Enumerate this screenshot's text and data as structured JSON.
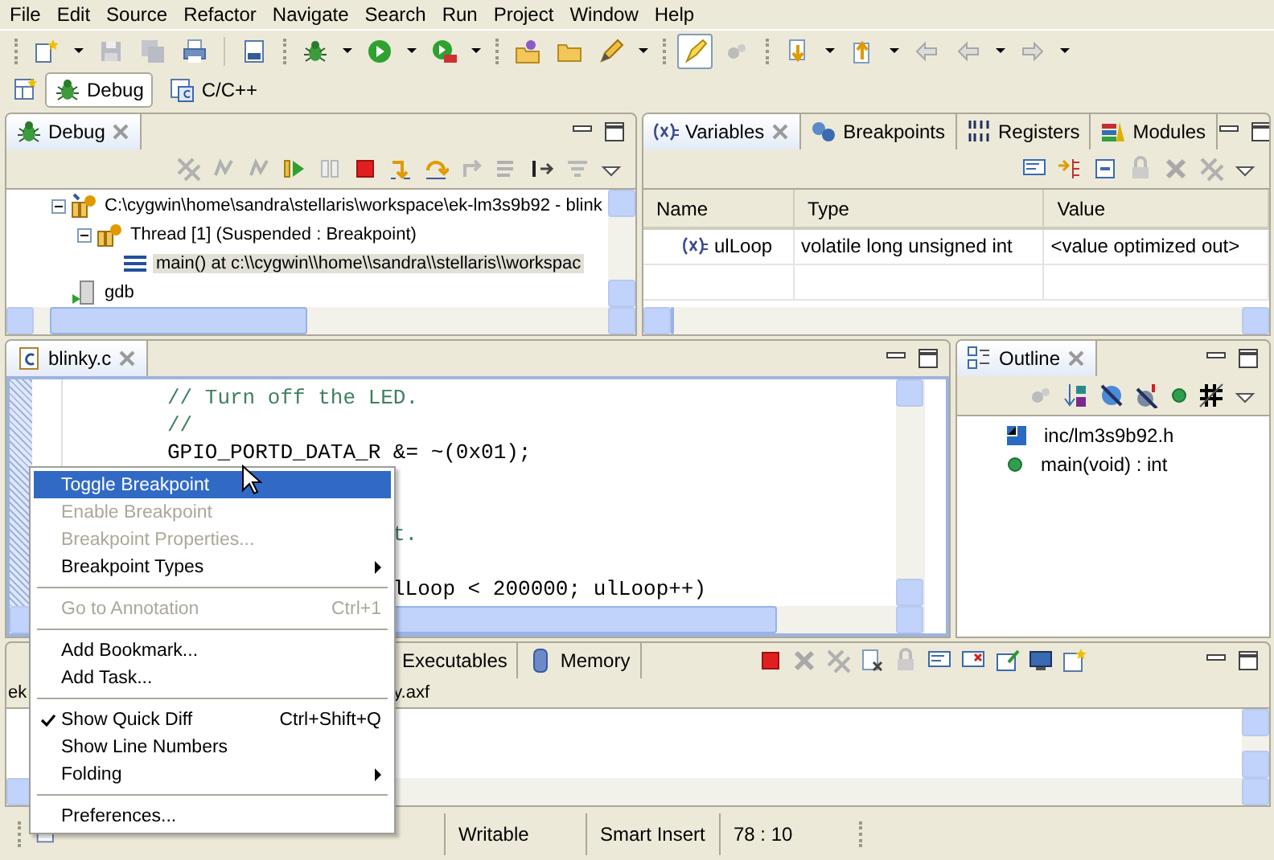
{
  "menu_bar": [
    "File",
    "Edit",
    "Source",
    "Refactor",
    "Navigate",
    "Search",
    "Run",
    "Project",
    "Window",
    "Help"
  ],
  "perspectives": [
    {
      "label": "Debug",
      "selected": true
    },
    {
      "label": "C/C++",
      "selected": false
    }
  ],
  "debug_view": {
    "tab": {
      "label": "Debug",
      "selected": true
    },
    "tree": [
      {
        "kind": "target",
        "label": "C:\\cygwin\\home\\sandra\\stellaris\\workspace\\ek-lm3s9b92 - blink",
        "expanded": true,
        "selected": false,
        "children": [
          {
            "kind": "thread",
            "label": "Thread [1] (Suspended : Breakpoint)",
            "expanded": true,
            "selected": false,
            "children": [
              {
                "kind": "frame",
                "label": "main() at c:\\\\cygwin\\\\home\\\\sandra\\\\stellaris\\\\workspac",
                "selected": true
              }
            ]
          }
        ]
      },
      {
        "kind": "process",
        "label": "gdb",
        "selected": false
      }
    ]
  },
  "variables_view": {
    "tabs": [
      {
        "kind": "variables",
        "label": "Variables",
        "selected": true
      },
      {
        "kind": "breakpoints",
        "label": "Breakpoints",
        "selected": false
      },
      {
        "kind": "registers",
        "label": "Registers",
        "selected": false
      },
      {
        "kind": "modules",
        "label": "Modules",
        "selected": false
      }
    ],
    "table": {
      "columns": [
        "Name",
        "Type",
        "Value"
      ],
      "rows": [
        [
          "ulLoop",
          "volatile long unsigned int",
          "<value optimized out>"
        ]
      ]
    }
  },
  "editor": {
    "tab": {
      "label": "blinky.c",
      "selected": true
    },
    "lines": [
      {
        "kind": "comment",
        "covered": false,
        "text": "// Turn off the LED."
      },
      {
        "kind": "comment",
        "covered": false,
        "text": "//"
      },
      {
        "kind": "code",
        "covered": false,
        "text": "GPIO_PORTD_DATA_R &= ~(0x01);"
      },
      {
        "kind": "hidden"
      },
      {
        "kind": "hidden"
      },
      {
        "kind": "comment",
        "covered": true,
        "text": "t."
      },
      {
        "kind": "hidden"
      },
      {
        "kind": "code",
        "covered": true,
        "text": "lLoop < 200000; ulLoop++)"
      }
    ]
  },
  "outline_view": {
    "tab": {
      "label": "Outline",
      "selected": true
    },
    "items": [
      {
        "kind": "include",
        "label": "inc/lm3s9b92.h",
        "selected": false
      },
      {
        "kind": "function",
        "label": "main(void) : int",
        "selected": false
      }
    ]
  },
  "console_view": {
    "tabs": [
      {
        "label": "Executables",
        "selected": false
      },
      {
        "label": "Memory",
        "selected": false
      }
    ],
    "line_start": "ek",
    "line_end": "y.axf"
  },
  "context_menu": [
    {
      "kind": "item",
      "label": "Toggle Breakpoint",
      "selected": true,
      "disabled": false,
      "checked": false,
      "submenu": false
    },
    {
      "kind": "item",
      "label": "Enable Breakpoint",
      "selected": false,
      "disabled": true,
      "checked": false,
      "submenu": false
    },
    {
      "kind": "item",
      "label": "Breakpoint Properties...",
      "selected": false,
      "disabled": true,
      "checked": false,
      "submenu": false
    },
    {
      "kind": "item",
      "label": "Breakpoint Types",
      "selected": false,
      "disabled": false,
      "checked": false,
      "submenu": true
    },
    {
      "kind": "separator"
    },
    {
      "kind": "item",
      "label": "Go to Annotation",
      "shortcut": "Ctrl+1",
      "selected": false,
      "disabled": true,
      "checked": false,
      "submenu": false
    },
    {
      "kind": "separator"
    },
    {
      "kind": "item",
      "label": "Add Bookmark...",
      "selected": false,
      "disabled": false,
      "checked": false,
      "submenu": false
    },
    {
      "kind": "item",
      "label": "Add Task...",
      "selected": false,
      "disabled": false,
      "checked": false,
      "submenu": false
    },
    {
      "kind": "separator"
    },
    {
      "kind": "item",
      "label": "Show Quick Diff",
      "shortcut": "Ctrl+Shift+Q",
      "selected": false,
      "disabled": false,
      "checked": true,
      "submenu": false
    },
    {
      "kind": "item",
      "label": "Show Line Numbers",
      "selected": false,
      "disabled": false,
      "checked": false,
      "submenu": false
    },
    {
      "kind": "item",
      "label": "Folding",
      "selected": false,
      "disabled": false,
      "checked": false,
      "submenu": true
    },
    {
      "kind": "separator"
    },
    {
      "kind": "item",
      "label": "Preferences...",
      "selected": false,
      "disabled": false,
      "checked": false,
      "submenu": false
    }
  ],
  "status_bar": [
    "Writable",
    "Smart Insert",
    "78 : 10"
  ]
}
